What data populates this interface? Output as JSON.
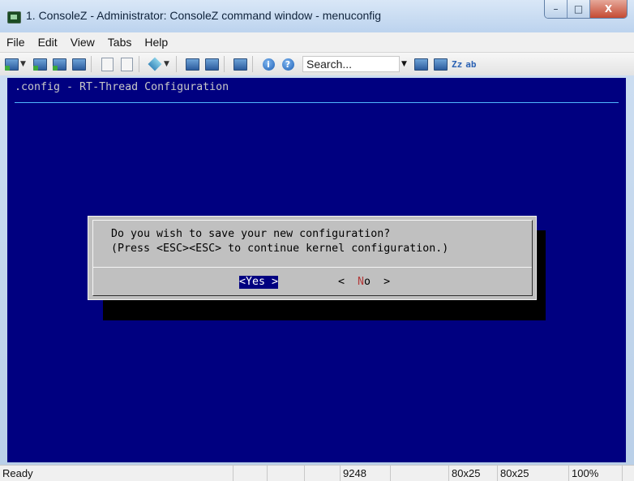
{
  "window": {
    "title": "1. ConsoleZ - Administrator: ConsoleZ command window - menuconfig",
    "minimize_label": "–",
    "maximize_label": "□",
    "close_label": "X"
  },
  "menubar": {
    "items": [
      "File",
      "Edit",
      "View",
      "Tabs",
      "Help"
    ]
  },
  "toolbar": {
    "search_placeholder": "Search...",
    "case_toggle_label": "Zz",
    "whole_word_label": "ab"
  },
  "console": {
    "header": ".config - RT-Thread Configuration",
    "dialog": {
      "line1": "Do you wish to save your new configuration?",
      "line2": "(Press <ESC><ESC> to continue kernel configuration.)",
      "yes_button": {
        "left": "<",
        "hotkey": "Y",
        "rest": "es",
        "right": " >"
      },
      "no_button": {
        "left": "<  ",
        "hotkey": "N",
        "rest": "o",
        "right": "  >"
      }
    },
    "colors": {
      "background": "#000080",
      "dialog": "#c0c0c0",
      "selected": "#000080",
      "hotkey": "#b33a3a"
    }
  },
  "statusbar": {
    "status": "Ready",
    "pid": "9248",
    "buffer_size": "80x25",
    "window_size": "80x25",
    "zoom": "100%"
  }
}
